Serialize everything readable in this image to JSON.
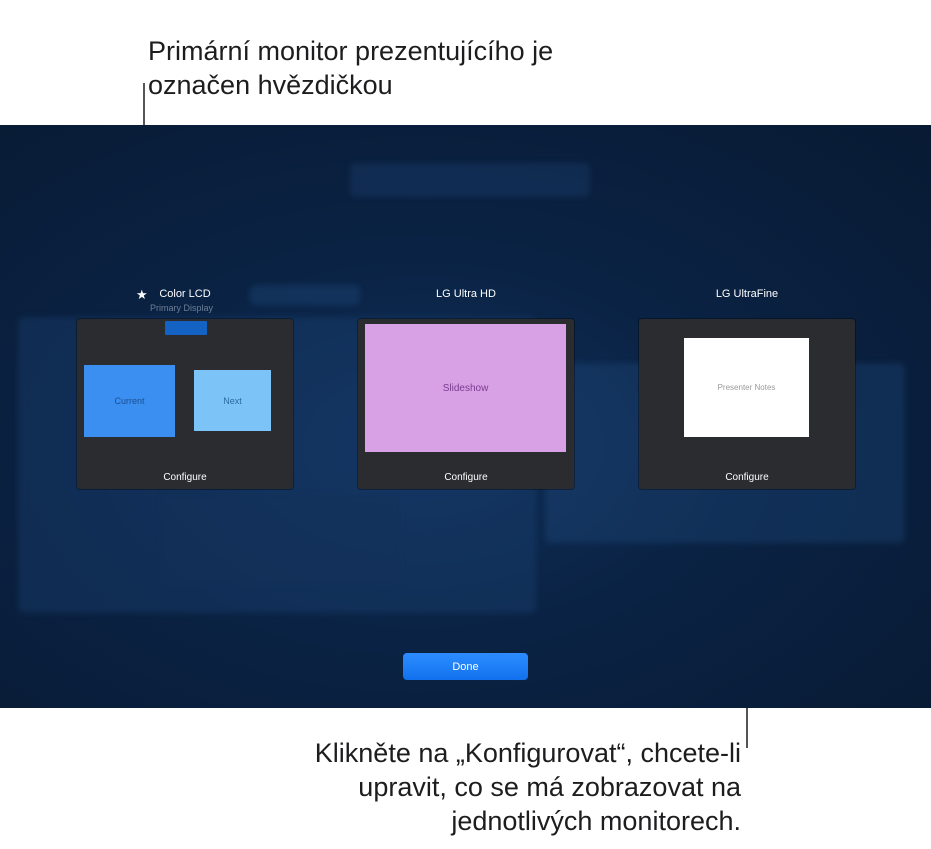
{
  "callouts": {
    "top_line1": "Primární monitor prezentujícího je",
    "top_line2": "označen hvězdičkou",
    "bottom_line1": "Klikněte na „Konfigurovat“, chcete-li",
    "bottom_line2": "upravit, co se má zobrazovat na",
    "bottom_line3": "jednotlivých monitorech."
  },
  "displays": [
    {
      "name": "Color LCD",
      "subtitle": "Primary Display",
      "primary": true,
      "tiles": [
        "Current",
        "Next"
      ],
      "configure_label": "Configure"
    },
    {
      "name": "LG Ultra HD",
      "tiles": [
        "Slideshow"
      ],
      "configure_label": "Configure"
    },
    {
      "name": "LG UltraFine",
      "tiles": [
        "Presenter Notes"
      ],
      "configure_label": "Configure"
    }
  ],
  "primary_marker": "★",
  "done_label": "Done",
  "colors": {
    "current_tile": "#3b8ff0",
    "next_tile": "#7cc4f7",
    "slideshow_tile": "#d9a1e5",
    "notes_tile": "#ffffff",
    "done_button": "#1a7cf5"
  }
}
